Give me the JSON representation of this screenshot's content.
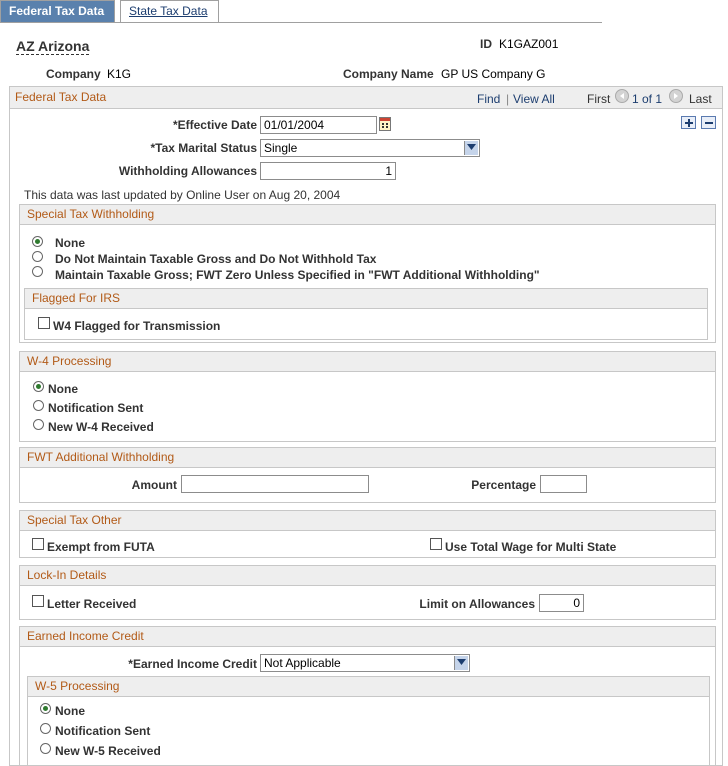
{
  "tabs": [
    {
      "label": "Federal Tax Data"
    },
    {
      "label": "State Tax Data"
    }
  ],
  "header": {
    "title": "AZ Arizona",
    "id_label": "ID",
    "id_value": "K1GAZ001",
    "company_label": "Company",
    "company_value": "K1G",
    "company_name_label": "Company Name",
    "company_name_value": "GP US Company G"
  },
  "federal_tax_data": {
    "section_title": "Federal Tax Data",
    "nav": {
      "find": "Find",
      "separator": "|",
      "view_all": "View All",
      "first": "First",
      "count": "1 of 1",
      "last": "Last"
    },
    "effective_date_label": "*Effective Date",
    "effective_date_value": "01/01/2004",
    "tax_marital_status_label": "*Tax Marital Status",
    "tax_marital_status_value": "Single",
    "withholding_allowances_label": "Withholding Allowances",
    "withholding_allowances_value": "1",
    "last_updated": "This data was last updated by Online User on Aug 20, 2004"
  },
  "special_tax_withholding": {
    "title": "Special Tax Withholding",
    "options": [
      {
        "label": "None",
        "selected": true
      },
      {
        "label": "Do Not Maintain Taxable Gross and Do Not Withhold Tax",
        "selected": false
      },
      {
        "label": "Maintain Taxable Gross; FWT Zero Unless Specified in \"FWT Additional Withholding\"",
        "selected": false
      }
    ],
    "flagged_for_irs": {
      "title": "Flagged For IRS",
      "checkbox_label": "W4 Flagged for Transmission"
    }
  },
  "w4_processing": {
    "title": "W-4 Processing",
    "options": [
      {
        "label": "None",
        "selected": true
      },
      {
        "label": "Notification Sent",
        "selected": false
      },
      {
        "label": "New W-4 Received",
        "selected": false
      }
    ]
  },
  "fwt_additional": {
    "title": "FWT Additional Withholding",
    "amount_label": "Amount",
    "amount_value": "",
    "percentage_label": "Percentage",
    "percentage_value": ""
  },
  "special_tax_other": {
    "title": "Special Tax Other",
    "exempt_futa_label": "Exempt from FUTA",
    "use_total_wage_label": "Use Total Wage for Multi State"
  },
  "lock_in": {
    "title": "Lock-In Details",
    "letter_received_label": "Letter Received",
    "limit_label": "Limit on Allowances",
    "limit_value": "0"
  },
  "earned_income": {
    "title": "Earned Income Credit",
    "eic_label": "*Earned Income Credit",
    "eic_value": "Not Applicable",
    "w5_title": "W-5 Processing",
    "w5_options": [
      {
        "label": "None",
        "selected": true
      },
      {
        "label": "Notification Sent",
        "selected": false
      },
      {
        "label": "New W-5 Received",
        "selected": false
      }
    ]
  },
  "colors": {
    "active_tab": "#5a81ad",
    "section_header_text": "#b25a17",
    "link": "#1c3d6f"
  }
}
